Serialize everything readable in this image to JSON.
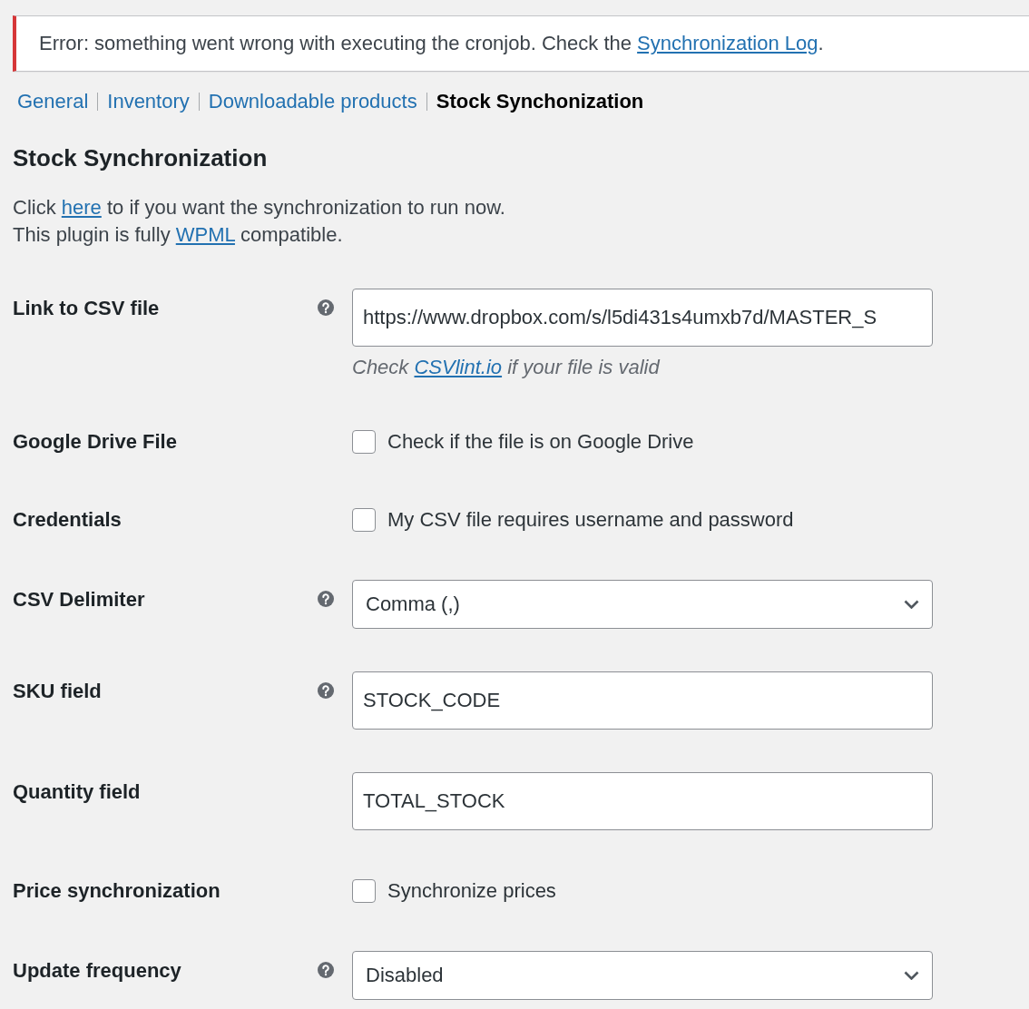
{
  "notice": {
    "kind": "error",
    "before": "Error: something went wrong with executing the cronjob. Check the ",
    "link": "Synchronization Log",
    "after": "."
  },
  "tabs": [
    {
      "label": "General",
      "selected": false
    },
    {
      "label": "Inventory",
      "selected": false
    },
    {
      "label": "Downloadable products",
      "selected": false
    },
    {
      "label": "Stock Synchonization",
      "selected": true
    }
  ],
  "heading": "Stock Synchronization",
  "intro_lines": [
    {
      "before": "Click ",
      "link": "here",
      "after": " to if you want the synchronization to run now."
    },
    {
      "before": "This plugin is fully ",
      "link": "WPML",
      "after": " compatible."
    }
  ],
  "fields": [
    {
      "kind": "text",
      "label": "Link to CSV file",
      "help": true,
      "value": "https://www.dropbox.com/s/l5di431s4umxb7d/MASTER_S",
      "description": {
        "before": "Check ",
        "link": "CSVlint.io",
        "after": " if your file is valid"
      }
    },
    {
      "kind": "checkbox",
      "label": "Google Drive File",
      "help": false,
      "checked": false,
      "option": "Check if the file is on Google Drive"
    },
    {
      "kind": "checkbox",
      "label": "Credentials",
      "help": false,
      "checked": false,
      "option": "My CSV file requires username and password"
    },
    {
      "kind": "select",
      "label": "CSV Delimiter",
      "help": true,
      "value": "Comma (,)"
    },
    {
      "kind": "text",
      "label": "SKU field",
      "help": true,
      "value": "STOCK_CODE"
    },
    {
      "kind": "text",
      "label": "Quantity field",
      "help": false,
      "value": "TOTAL_STOCK"
    },
    {
      "kind": "checkbox",
      "label": "Price synchronization",
      "help": false,
      "checked": false,
      "option": "Synchronize prices"
    },
    {
      "kind": "select",
      "label": "Update frequency",
      "help": true,
      "value": "Disabled"
    }
  ]
}
